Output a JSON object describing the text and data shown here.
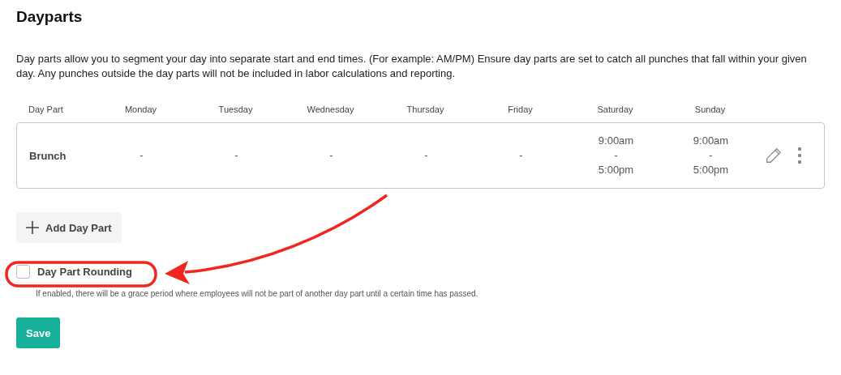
{
  "title": "Dayparts",
  "description": "Day parts allow you to segment your day into separate start and end times. (For example: AM/PM) Ensure day parts are set to catch all punches that fall within your given day. Any punches outside the day parts will not be included in labor calculations and reporting.",
  "table": {
    "columns": [
      "Day Part",
      "Monday",
      "Tuesday",
      "Wednesday",
      "Thursday",
      "Friday",
      "Saturday",
      "Sunday"
    ],
    "rows": [
      {
        "cells": [
          [
            "Brunch"
          ],
          [
            "-"
          ],
          [
            "-"
          ],
          [
            "-"
          ],
          [
            "-"
          ],
          [
            "-"
          ],
          [
            "9:00am",
            "-",
            "5:00pm"
          ],
          [
            "9:00am",
            "-",
            "5:00pm"
          ]
        ]
      }
    ]
  },
  "add_button": "Add Day Part",
  "rounding": {
    "label": "Day Part Rounding",
    "checked": false,
    "help": "If enabled, there will be a grace period where employees will not be part of another day part until a certain time has passed."
  },
  "save_button": "Save"
}
